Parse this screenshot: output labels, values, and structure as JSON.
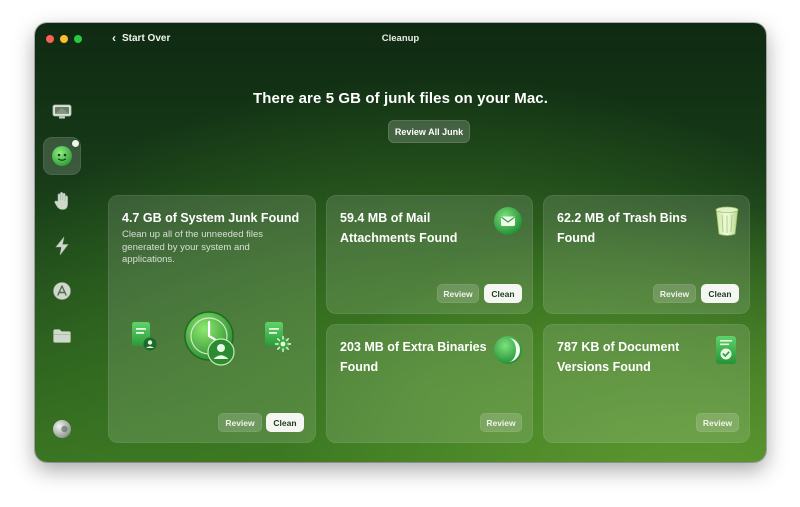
{
  "window": {
    "title": "Cleanup"
  },
  "nav": {
    "back_label": "Start Over"
  },
  "sidebar": {
    "items": [
      {
        "name": "smart-care",
        "icon": "monitor-icon"
      },
      {
        "name": "cleanup",
        "icon": "cleanup-globe-icon",
        "active": true
      },
      {
        "name": "protection",
        "icon": "hand-icon"
      },
      {
        "name": "performance",
        "icon": "lightning-icon"
      },
      {
        "name": "applications",
        "icon": "apps-icon"
      },
      {
        "name": "my-clutter",
        "icon": "folder-icon"
      },
      {
        "name": "assistant",
        "icon": "assistant-orb-icon"
      }
    ]
  },
  "header": {
    "headline": "There are 5 GB of junk files on your Mac.",
    "review_all_label": "Review All Junk"
  },
  "cards": {
    "system_junk": {
      "title": "4.7 GB of System Junk Found",
      "description": "Clean up all of the unneeded files generated by your system and applications.",
      "review_label": "Review",
      "clean_label": "Clean"
    },
    "mail": {
      "title_line1": "59.4 MB of Mail",
      "title_line2": "Attachments Found",
      "review_label": "Review",
      "clean_label": "Clean"
    },
    "trash": {
      "title_line1": "62.2 MB of Trash Bins",
      "title_line2": "Found",
      "review_label": "Review",
      "clean_label": "Clean"
    },
    "binaries": {
      "title_line1": "203 MB of Extra Binaries",
      "title_line2": "Found",
      "review_label": "Review"
    },
    "doc_versions": {
      "title_line1": "787 KB of Document",
      "title_line2": "Versions Found",
      "review_label": "Review"
    }
  },
  "colors": {
    "accent_green": "#3fb34f",
    "bg_dark": "#0f2a12",
    "bg_light": "#5f9b30"
  }
}
